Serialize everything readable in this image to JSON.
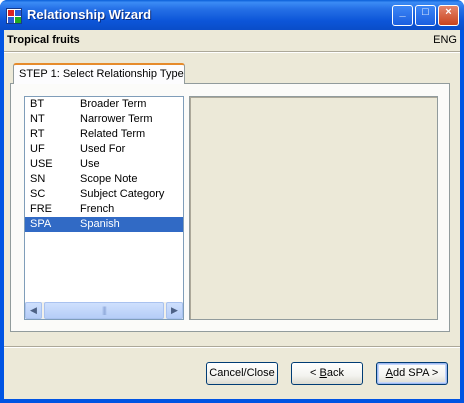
{
  "window": {
    "title": "Relationship Wizard",
    "buttons": {
      "minimize": "_",
      "maximize": "□",
      "close": "×"
    }
  },
  "header": {
    "title": "Tropical fruits",
    "language": "ENG"
  },
  "tab": {
    "label": "STEP 1: Select Relationship Type"
  },
  "relationship_list": {
    "items": [
      {
        "code": "BT",
        "label": "Broader Term"
      },
      {
        "code": "NT",
        "label": "Narrower Term"
      },
      {
        "code": "RT",
        "label": "Related Term"
      },
      {
        "code": "UF",
        "label": "Used For"
      },
      {
        "code": "USE",
        "label": "Use"
      },
      {
        "code": "SN",
        "label": "Scope Note"
      },
      {
        "code": "SC",
        "label": "Subject Category"
      },
      {
        "code": "FRE",
        "label": "French"
      },
      {
        "code": "SPA",
        "label": "Spanish"
      }
    ],
    "selected_code": "SPA",
    "scroll_left": "◀",
    "scroll_right": "▶",
    "scroll_grip": "|||"
  },
  "actions": {
    "cancel_label": "Cancel/Close",
    "back_prefix": "< ",
    "back_mnemonic": "B",
    "back_rest": "ack",
    "add_mnemonic": "A",
    "add_rest": "dd SPA >"
  },
  "colors": {
    "selection": "#316ac5",
    "titlebar": "#0054e3",
    "tab_highlight": "#e68b2c",
    "dialog_bg": "#ece9d8"
  }
}
